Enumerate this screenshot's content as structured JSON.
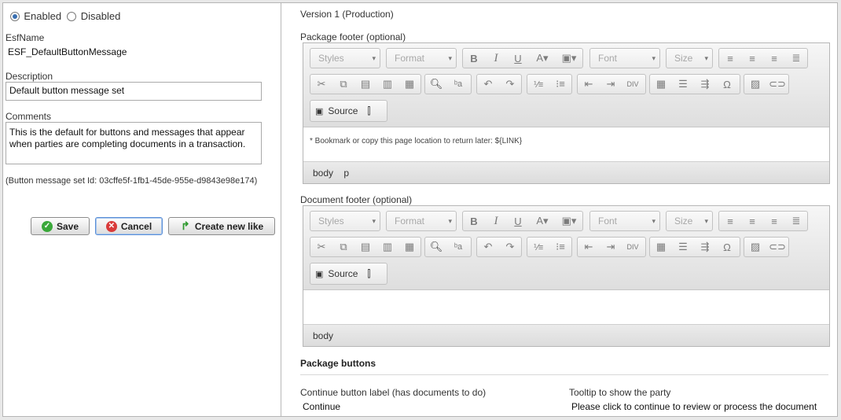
{
  "status": {
    "enabled_label": "Enabled",
    "disabled_label": "Disabled",
    "selected": "Enabled"
  },
  "esf_name": {
    "label": "EsfName",
    "value": "ESF_DefaultButtonMessage"
  },
  "description": {
    "label": "Description",
    "value": "Default button message set"
  },
  "comments": {
    "label": "Comments",
    "value": "This is the default for buttons and messages that appear when parties are completing documents in a transaction."
  },
  "set_id_text": "(Button message set Id: 03cffe5f-1fb1-45de-955e-d9843e98e174)",
  "buttons": {
    "save": "Save",
    "cancel": "Cancel",
    "create_new_like": "Create new like"
  },
  "version_text": "Version 1 (Production)",
  "editor_toolbar": {
    "styles": "Styles",
    "format": "Format",
    "font": "Font",
    "size": "Size",
    "source": "Source"
  },
  "package_footer": {
    "label": "Package footer (optional)",
    "content": "* Bookmark or copy this page location to return later: ${LINK}",
    "path": [
      "body",
      "p"
    ]
  },
  "document_footer": {
    "label": "Document footer (optional)",
    "content": "",
    "path": [
      "body"
    ]
  },
  "package_buttons": {
    "heading": "Package buttons",
    "continue_label_heading": "Continue button label (has documents to do)",
    "continue_label_value": "Continue",
    "tooltip_heading": "Tooltip to show the party",
    "tooltip_value": "Please click to continue to review or process the document"
  }
}
